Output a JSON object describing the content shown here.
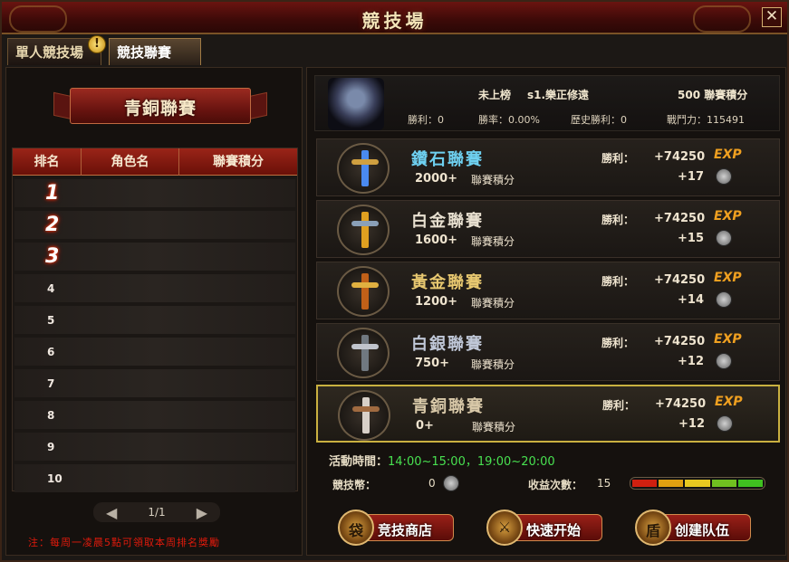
{
  "window": {
    "title": "競技場",
    "close_symbol": "✕"
  },
  "tabs": [
    {
      "label": "單人競技場",
      "alert": "!"
    },
    {
      "label": "競技聯賽"
    }
  ],
  "left": {
    "banner_title": "青銅聯賽",
    "table_headers": [
      "排名",
      "角色名",
      "聯賽積分"
    ],
    "rows": [
      "1",
      "2",
      "3",
      "4",
      "5",
      "6",
      "7",
      "8",
      "9",
      "10"
    ],
    "pager": {
      "prev": "◀",
      "text": "1/1",
      "next": "▶"
    },
    "note": "注：每周一凌晨5點可領取本周排名獎勵"
  },
  "player": {
    "rank_status": "未上榜",
    "name": "s1.樂正修遠",
    "points_text": "500 聯賽積分",
    "wins": "勝利：0",
    "win_rate": "勝率：0.00%",
    "history_wins": "歷史勝利：0",
    "power": "戰鬥力：115491"
  },
  "leagues": [
    {
      "name": "鑽石聯賽",
      "min": "2000+",
      "unit": "聯賽積分",
      "win_label": "勝利：",
      "exp": "+74250",
      "exp_tag": "EXP",
      "coins": "+17",
      "name_color": "#6ed0f0",
      "blade": "#4a8af0",
      "guard": "#d0a040"
    },
    {
      "name": "白金聯賽",
      "min": "1600+",
      "unit": "聯賽積分",
      "win_label": "勝利：",
      "exp": "+74250",
      "exp_tag": "EXP",
      "coins": "+15",
      "name_color": "#e8e0d0",
      "blade": "#e0a020",
      "guard": "#8aa0b8"
    },
    {
      "name": "黃金聯賽",
      "min": "1200+",
      "unit": "聯賽積分",
      "win_label": "勝利：",
      "exp": "+74250",
      "exp_tag": "EXP",
      "coins": "+14",
      "name_color": "#e8c870",
      "blade": "#c06018",
      "guard": "#e0b040"
    },
    {
      "name": "白銀聯賽",
      "min": "750+",
      "unit": "聯賽積分",
      "win_label": "勝利：",
      "exp": "+74250",
      "exp_tag": "EXP",
      "coins": "+12",
      "name_color": "#c0c8d8",
      "blade": "#707880",
      "guard": "#c0c4cc"
    },
    {
      "name": "青銅聯賽",
      "min": "0+",
      "unit": "聯賽積分",
      "win_label": "勝利：",
      "exp": "+74250",
      "exp_tag": "EXP",
      "coins": "+12",
      "name_color": "#d8c8a8",
      "blade": "#d8d0c8",
      "guard": "#a06a40",
      "active": true
    }
  ],
  "info": {
    "time_label": "活動時間：",
    "time_value": "14:00~15:00，19:00~20:00",
    "coin_label": "競技幣：",
    "coin_value": "0",
    "gain_label": "收益次數：",
    "gain_value": "15",
    "gain_colors": [
      "#d02010",
      "#e0a010",
      "#e8c820",
      "#70c020",
      "#40c020"
    ]
  },
  "actions": [
    {
      "label": "竞技商店",
      "icon": "shop-bag-icon",
      "glyph": "袋"
    },
    {
      "label": "快速开始",
      "icon": "crossed-swords-icon",
      "glyph": "⚔"
    },
    {
      "label": "创建队伍",
      "icon": "shield-team-icon",
      "glyph": "盾"
    }
  ]
}
